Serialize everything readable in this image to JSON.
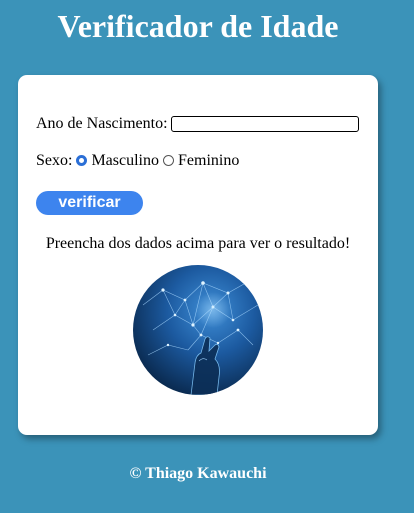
{
  "header": {
    "title": "Verificador de Idade"
  },
  "form": {
    "year_label": "Ano de Nascimento:",
    "year_value": "",
    "sex_label": "Sexo:",
    "sex_options": [
      {
        "label": "Masculino",
        "checked": true
      },
      {
        "label": "Feminino",
        "checked": false
      }
    ],
    "verify_label": "verificar"
  },
  "result": {
    "text": "Preencha dos dados acima para ver o resultado!",
    "image_icon": "network-hand-image"
  },
  "footer": {
    "text": "© Thiago Kawauchi"
  },
  "colors": {
    "background": "#3b93b9",
    "card": "#ffffff",
    "button": "#3d84ee",
    "radio_checked": "#2b6fd6"
  }
}
